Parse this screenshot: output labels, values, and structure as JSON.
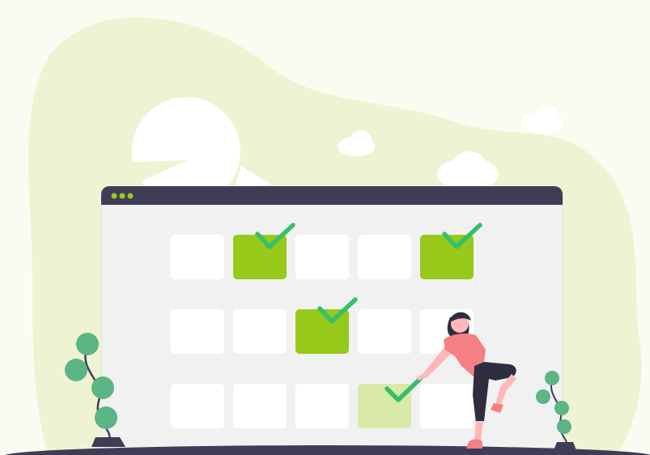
{
  "illustration": {
    "theme": "calendar-schedule",
    "colors": {
      "background": "#fbfcf1",
      "blob": "#eef4d3",
      "window_frame": "#3f3d56",
      "window_body": "#f1f1f1",
      "cell": "#ffffff",
      "cell_checked": "#97c91a",
      "cell_pending": "#d9e9a8",
      "check": "#33c06a",
      "window_dots": "#97c91a",
      "ground": "#3f3d56",
      "plant": "#5bb585",
      "person_shirt": "#f47f84",
      "person_pants": "#2f2e41",
      "person_skin": "#ffb8b8"
    },
    "calendar": {
      "rows": [
        [
          "empty",
          "checked",
          "empty",
          "empty",
          "checked"
        ],
        [
          "empty",
          "empty",
          "checked",
          "empty",
          "empty"
        ],
        [
          "empty",
          "empty",
          "empty",
          "pending",
          "empty"
        ]
      ]
    }
  }
}
